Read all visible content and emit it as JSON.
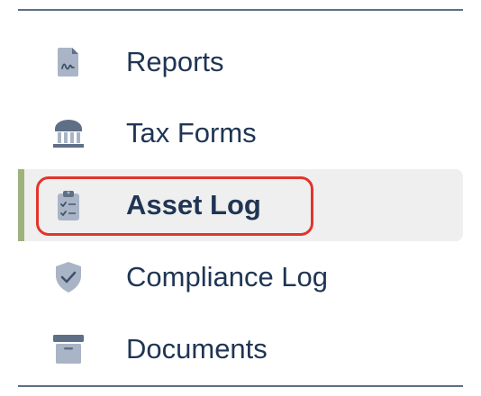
{
  "nav": {
    "items": [
      {
        "label": "Reports",
        "icon": "report-document-icon"
      },
      {
        "label": "Tax Forms",
        "icon": "bank-building-icon"
      },
      {
        "label": "Asset Log",
        "icon": "clipboard-checklist-icon",
        "active": true,
        "highlighted": true
      },
      {
        "label": "Compliance Log",
        "icon": "shield-check-icon"
      },
      {
        "label": "Documents",
        "icon": "archive-box-icon"
      }
    ]
  },
  "colors": {
    "text": "#1f3553",
    "icon": "#5e6f86",
    "icon_light": "#a9b5c6",
    "active_background": "#efefef",
    "active_accent": "#9db27c",
    "highlight_ring": "#e3342a",
    "divider": "#5d6e84"
  }
}
